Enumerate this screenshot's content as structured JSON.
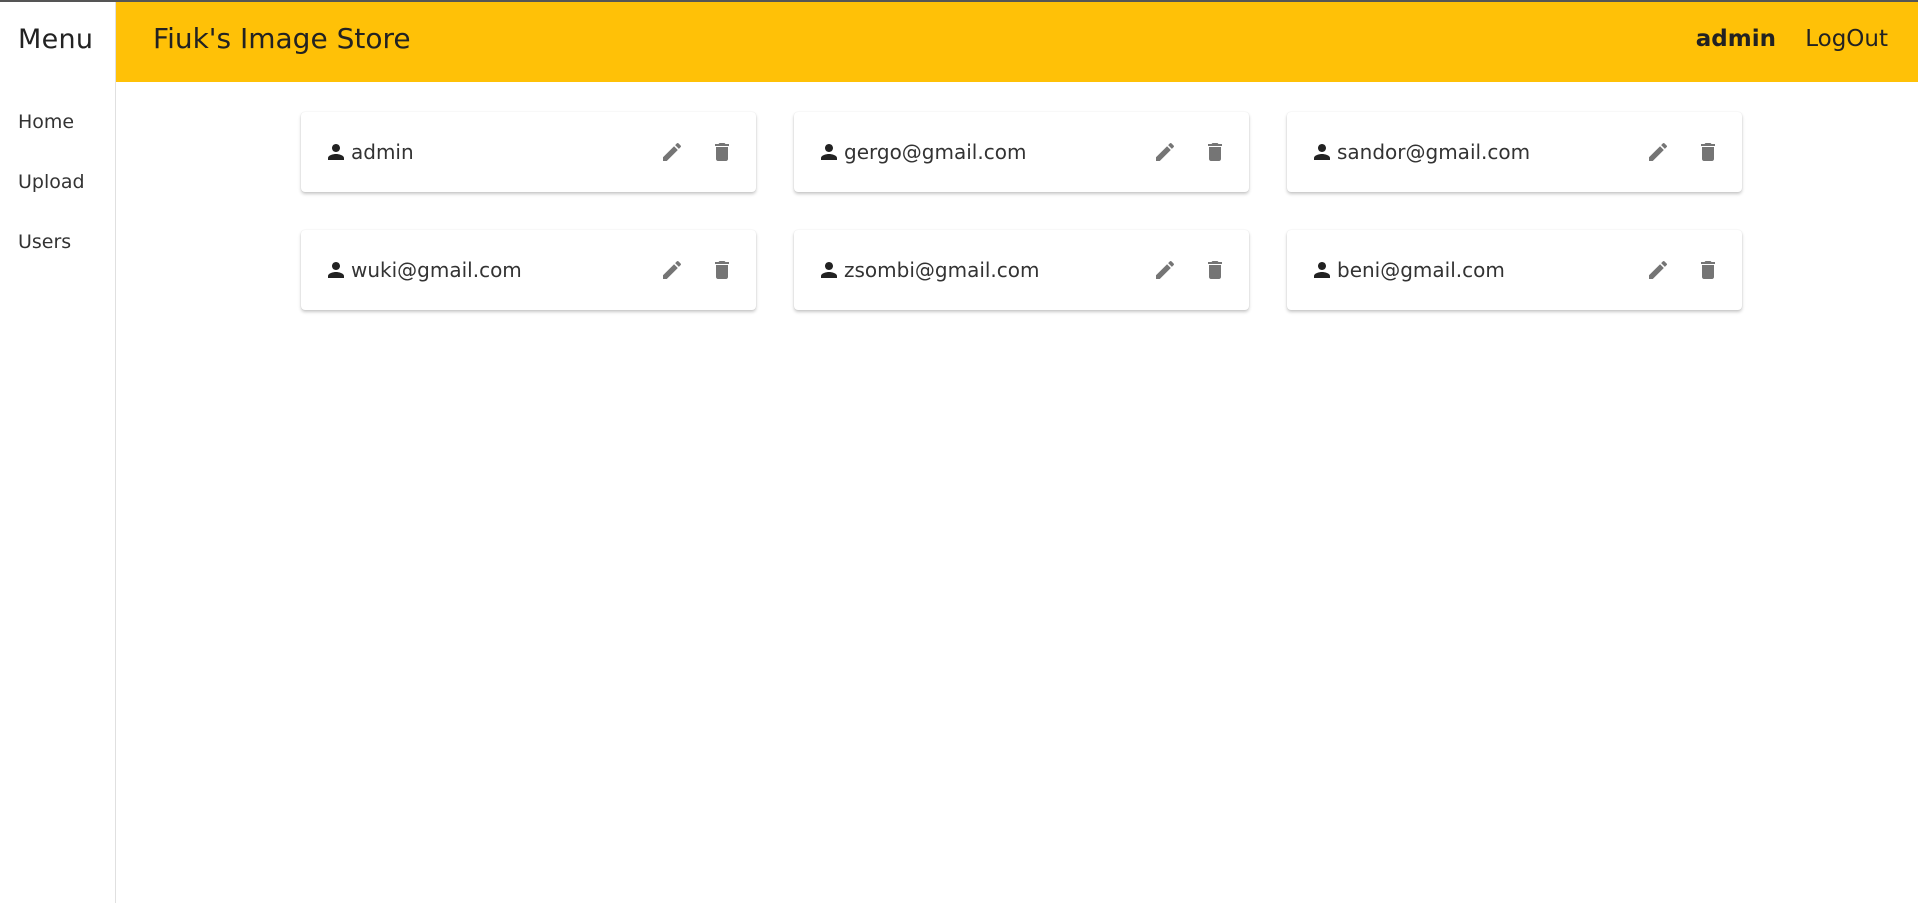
{
  "sidebar": {
    "title": "Menu",
    "items": [
      {
        "label": "Home"
      },
      {
        "label": "Upload"
      },
      {
        "label": "Users"
      }
    ]
  },
  "header": {
    "title": "Fiuk's Image Store",
    "current_user": "admin",
    "logout_label": "LogOut"
  },
  "users": [
    {
      "email": "admin"
    },
    {
      "email": "gergo@gmail.com"
    },
    {
      "email": "sandor@gmail.com"
    },
    {
      "email": "wuki@gmail.com"
    },
    {
      "email": "zsombi@gmail.com"
    },
    {
      "email": "beni@gmail.com"
    }
  ],
  "icons": {
    "user": "person-icon",
    "edit": "pencil-icon",
    "delete": "trash-icon"
  },
  "colors": {
    "header_bg": "#ffc107",
    "icon_gray": "#757575"
  }
}
